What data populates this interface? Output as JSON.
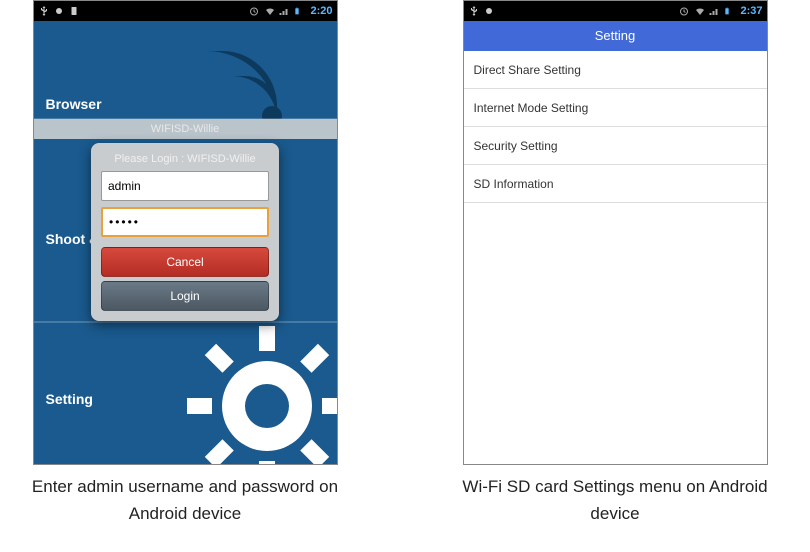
{
  "left": {
    "status": {
      "time": "2:20"
    },
    "sections": {
      "browser_label": "Browser",
      "shoot_label": "Shoot & V",
      "setting_label": "Setting"
    },
    "banner": "WIFISD-Willie",
    "dialog": {
      "title": "Please Login : WIFISD-Willie",
      "username_value": "admin",
      "password_value": "•••••",
      "cancel_label": "Cancel",
      "login_label": "Login"
    },
    "caption": "Enter admin username and password on Android device"
  },
  "right": {
    "status": {
      "time": "2:37"
    },
    "header": "Setting",
    "items": [
      "Direct Share Setting",
      "Internet Mode Setting",
      "Security Setting",
      "SD Information"
    ],
    "caption": "Wi-Fi SD card Settings menu on Android device"
  }
}
